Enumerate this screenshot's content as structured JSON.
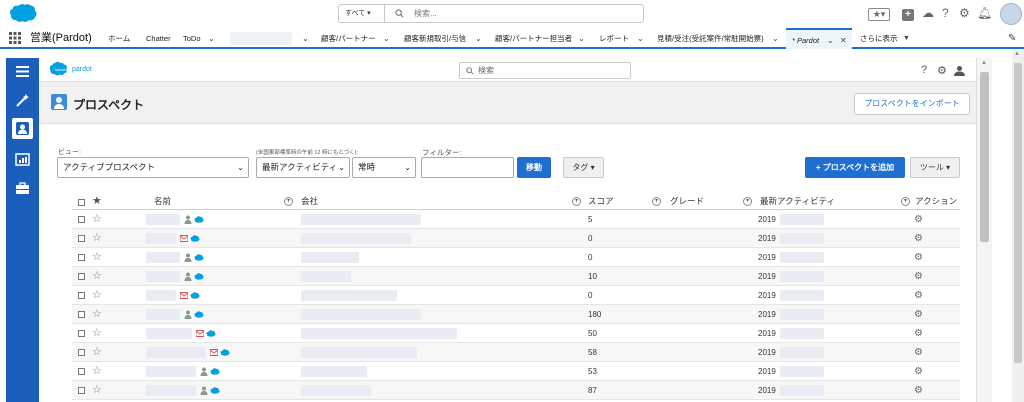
{
  "global": {
    "search_scope": "すべて",
    "search_placeholder": "検索..."
  },
  "nav": {
    "app_name": "営業(Pardot)",
    "tabs": [
      {
        "label": "ホーム"
      },
      {
        "label": "Chatter"
      },
      {
        "label": "ToDo"
      },
      {
        "label": "顧客/パートナー"
      },
      {
        "label": "顧客新規取引/与信"
      },
      {
        "label": "顧客/パートナー担当者"
      },
      {
        "label": "レポート"
      },
      {
        "label": "見積/受注(受託案件/常駐開始票)"
      },
      {
        "label": "* Pardot"
      },
      {
        "label": "さらに表示"
      }
    ]
  },
  "pardot": {
    "logo_text": "pardot",
    "search_placeholder": "検索"
  },
  "page": {
    "title": "プロスペクト",
    "import_button": "プロスペクトをインポート"
  },
  "filters": {
    "view_label": "ビュー:",
    "view_value": "アクティブプロスペクト",
    "time_note": "(米国東部標準時の午前 12 時にもとづく):",
    "activity_value": "最新アクティビティ",
    "period_value": "常時",
    "filter_label": "フィルター:",
    "filter_value": "",
    "go_button": "移動",
    "tag_button": "タグ",
    "add_button": "+ プロスペクトを追加",
    "tools_button": "ツール"
  },
  "table": {
    "headers": {
      "name": "名前",
      "company": "会社",
      "score": "スコア",
      "grade": "グレード",
      "activity": "最新アクティビティ",
      "action": "アクション"
    },
    "rows": [
      {
        "score": "5",
        "activity": "2019",
        "icon": "person"
      },
      {
        "score": "0",
        "activity": "2019",
        "icon": "mail"
      },
      {
        "score": "0",
        "activity": "2019",
        "icon": "person"
      },
      {
        "score": "10",
        "activity": "2019",
        "icon": "person"
      },
      {
        "score": "0",
        "activity": "2019",
        "icon": "mail"
      },
      {
        "score": "180",
        "activity": "2019",
        "icon": "person"
      },
      {
        "score": "50",
        "activity": "2019",
        "icon": "mail"
      },
      {
        "score": "58",
        "activity": "2019",
        "icon": "mail"
      },
      {
        "score": "53",
        "activity": "2019",
        "icon": "person"
      },
      {
        "score": "87",
        "activity": "2019",
        "icon": "person"
      }
    ]
  },
  "colors": {
    "brand_blue": "#1f6fd1",
    "sidebar": "#1b5fba",
    "salesforce_cloud": "#00a1e0"
  }
}
